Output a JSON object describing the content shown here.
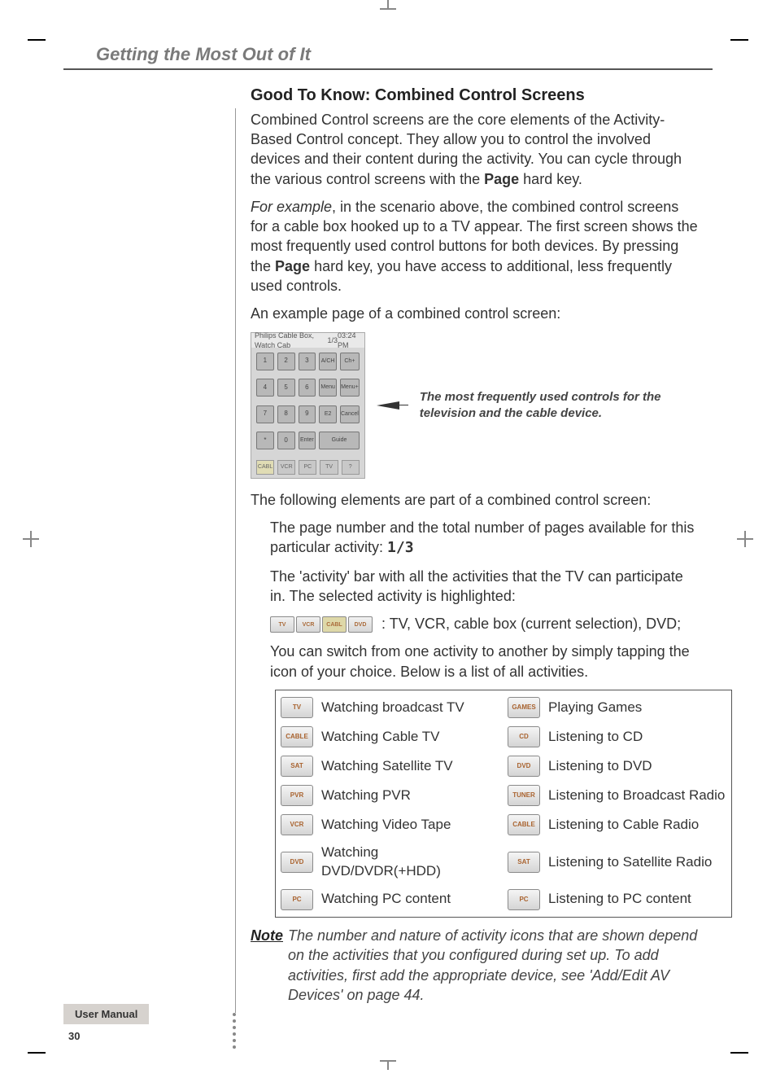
{
  "header_title": "Getting the Most Out of It",
  "section": {
    "heading": "Good To Know: Combined Control Screens",
    "p1_a": "Combined Control screens are the core elements of the Activity-Based Control concept. They allow you to control the involved devices and their content during the activity. You can cycle through the various control screens with the ",
    "p1_b": "Page",
    "p1_c": " hard key.",
    "p2_a": "For example",
    "p2_b": ", in the scenario above, the combined control screens for a cable box hooked up to a TV appear. The first screen shows the most frequently used control buttons for both devices. By pressing the ",
    "p2_c": "Page",
    "p2_d": " hard key, you have access to additional, less frequently used controls.",
    "p3": "An example page of a combined control screen:",
    "screenshot_title": "Philips Cable Box, Watch Cab",
    "screenshot_indicator": "1/3",
    "screenshot_time": "03:24 PM",
    "screenshot_buttons": [
      "1",
      "2",
      "3",
      "A/CH",
      "Ch+",
      "4",
      "5",
      "6",
      "Menu",
      "Menu+",
      "7",
      "8",
      "9",
      "E2",
      "Cancel",
      "*",
      "0",
      "Enter",
      "",
      "Guide"
    ],
    "screenshot_tabs": [
      "CABL",
      "VCR",
      "PC",
      "TV"
    ],
    "callout": "The most frequently used controls for the television and the cable device.",
    "p4": "The following elements are part of a combined control screen:",
    "bullet1_a": "The page number and the total number of pages available for this particular activity: ",
    "bullet1_b": "1/3",
    "bullet2": "The 'activity' bar with all the activities that the TV can participate in. The selected activity is highlighted:",
    "bar_labels": [
      "TV",
      "VCR",
      "CABL",
      "DVD"
    ],
    "bar_caption": " : TV, VCR, cable box (current selection), DVD;",
    "p5": "You can switch from one activity to another by simply tapping the icon of your choice. Below is a list of all activities.",
    "activities_left": [
      {
        "icon": "TV",
        "label": "Watching broadcast TV"
      },
      {
        "icon": "CABLE",
        "label": "Watching Cable TV"
      },
      {
        "icon": "SAT",
        "label": "Watching Satellite TV"
      },
      {
        "icon": "PVR",
        "label": "Watching PVR"
      },
      {
        "icon": "VCR",
        "label": "Watching Video Tape"
      },
      {
        "icon": "DVD",
        "label": "Watching DVD/DVDR(+HDD)"
      },
      {
        "icon": "PC",
        "label": "Watching PC content"
      }
    ],
    "activities_right": [
      {
        "icon": "GAMES",
        "label": "Playing Games"
      },
      {
        "icon": "CD",
        "label": "Listening to CD"
      },
      {
        "icon": "DVD",
        "label": "Listening to DVD"
      },
      {
        "icon": "TUNER",
        "label": "Listening to Broadcast Radio"
      },
      {
        "icon": "CABLE",
        "label": "Listening to Cable Radio"
      },
      {
        "icon": "SAT",
        "label": "Listening to Satellite Radio"
      },
      {
        "icon": "PC",
        "label": "Listening to PC content"
      }
    ],
    "note_label": "Note",
    "note_text": "The number and nature of activity icons that are shown depend on the activities that you configured during set up. To add activities, first add the appropriate device, see 'Add/Edit AV Devices' on page 44."
  },
  "footer": {
    "label": "User Manual",
    "page_number": "30"
  }
}
